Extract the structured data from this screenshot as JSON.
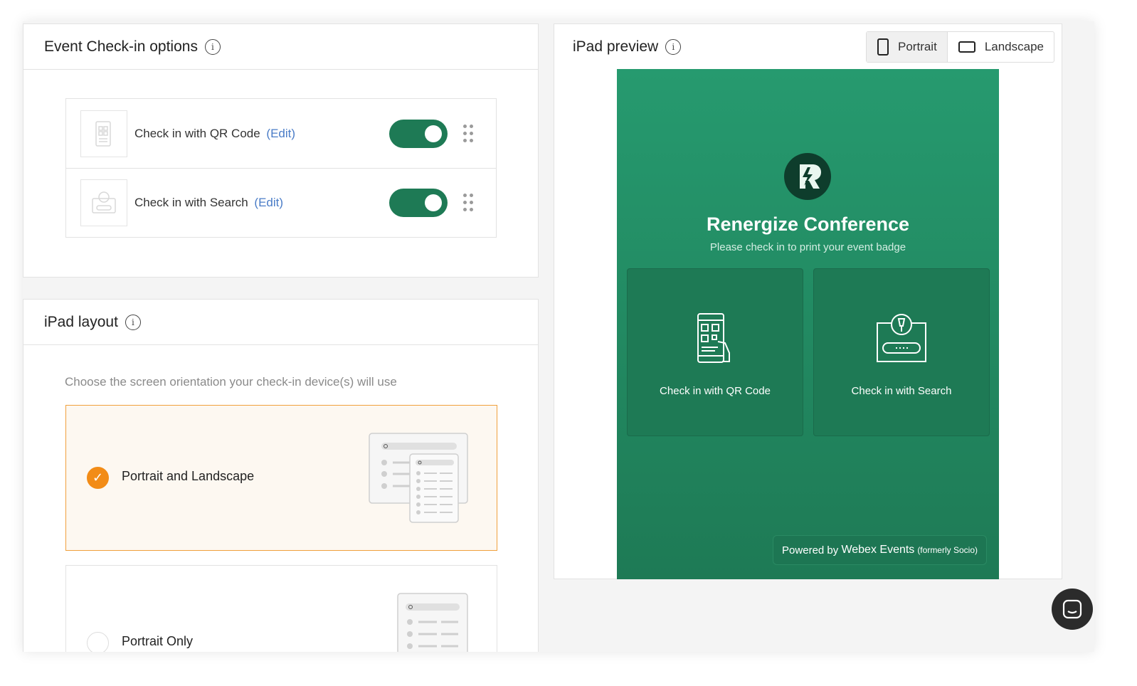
{
  "checkin_options": {
    "title": "Event Check-in options",
    "items": [
      {
        "label": "Check in with QR Code",
        "edit": "(Edit)",
        "enabled": true,
        "thumb_icon": "qr-phone-icon"
      },
      {
        "label": "Check in with Search",
        "edit": "(Edit)",
        "enabled": true,
        "thumb_icon": "search-kiosk-icon"
      }
    ]
  },
  "ipad_layout": {
    "title": "iPad layout",
    "description": "Choose the screen orientation your check-in device(s) will use",
    "options": [
      {
        "label": "Portrait and Landscape",
        "selected": true
      },
      {
        "label": "Portrait Only",
        "selected": false
      }
    ]
  },
  "preview": {
    "title": "iPad preview",
    "orientation_buttons": [
      {
        "label": "Portrait",
        "active": true
      },
      {
        "label": "Landscape",
        "active": false
      }
    ],
    "event_title": "Renergize Conference",
    "event_subtitle": "Please check in to print your event badge",
    "tiles": [
      {
        "label": "Check in with QR Code"
      },
      {
        "label": "Check in with Search"
      }
    ],
    "powered_by": "Powered by",
    "powered_brand": "Webex Events",
    "powered_note": "(formerly Socio)"
  },
  "colors": {
    "toggle_on": "#1e7a55",
    "preview_green": "#269a6f",
    "selected_accent": "#f28c17",
    "link": "#4a7cc7"
  }
}
